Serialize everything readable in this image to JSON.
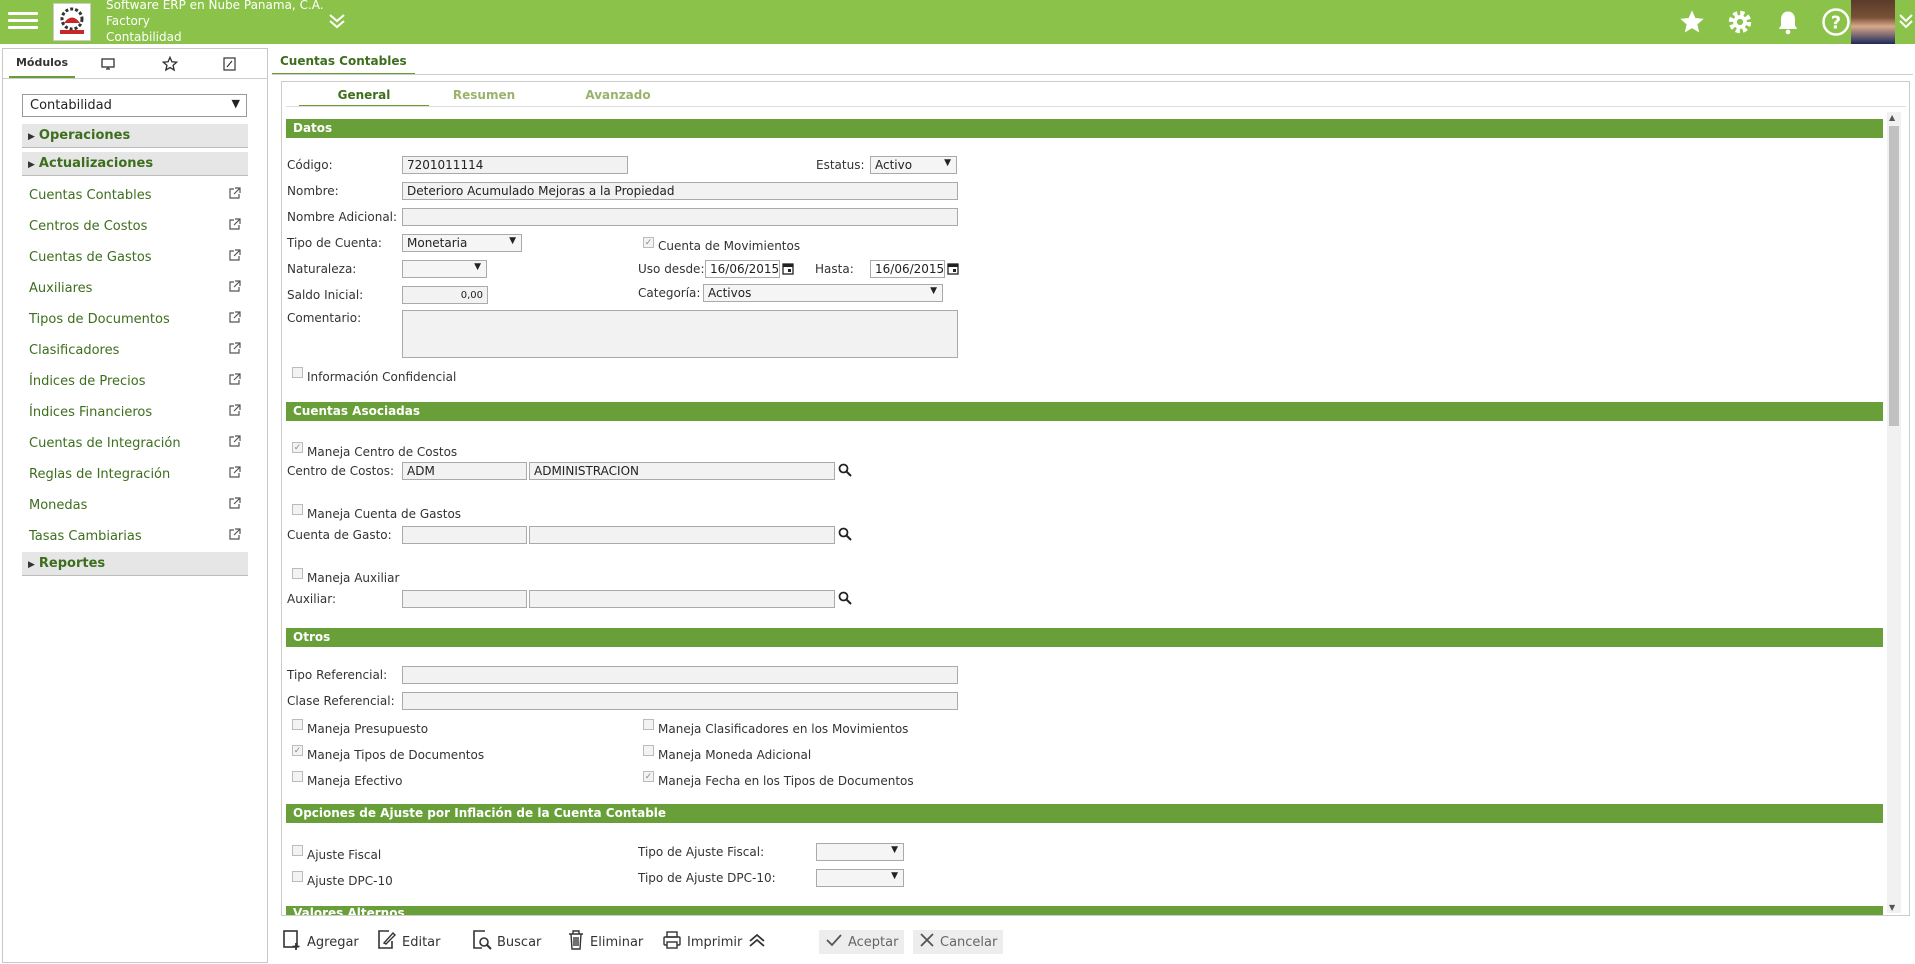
{
  "header": {
    "company": "Software ERP en Nube Panama, C.A.",
    "app": "Factory",
    "module": "Contabilidad"
  },
  "sidebar": {
    "tab_modules": "Módulos",
    "module_select": "Contabilidad",
    "groups": {
      "operaciones": "Operaciones",
      "actualizaciones": "Actualizaciones",
      "reportes": "Reportes"
    },
    "items": [
      {
        "label": "Cuentas Contables"
      },
      {
        "label": "Centros de Costos"
      },
      {
        "label": "Cuentas de Gastos"
      },
      {
        "label": "Auxiliares"
      },
      {
        "label": "Tipos de Documentos"
      },
      {
        "label": "Clasificadores"
      },
      {
        "label": "Índices de Precios"
      },
      {
        "label": "Índices Financieros"
      },
      {
        "label": "Cuentas de Integración"
      },
      {
        "label": "Reglas de Integración"
      },
      {
        "label": "Monedas"
      },
      {
        "label": "Tasas Cambiarias"
      }
    ]
  },
  "main": {
    "tab_title": "Cuentas Contables",
    "subtabs": [
      "General",
      "Resumen",
      "Avanzado"
    ],
    "sections": {
      "datos": "Datos",
      "cuentas_asociadas": "Cuentas Asociadas",
      "otros": "Otros",
      "ajuste": "Opciones de Ajuste por Inflación de la Cuenta Contable",
      "valores": "Valores Alternos"
    },
    "form": {
      "codigo_label": "Código:",
      "codigo_value": "7201011114",
      "estatus_label": "Estatus:",
      "estatus_value": "Activo",
      "nombre_label": "Nombre:",
      "nombre_value": "Deterioro Acumulado Mejoras a la Propiedad",
      "nombre_adicional_label": "Nombre Adicional:",
      "nombre_adicional_value": "",
      "tipo_cuenta_label": "Tipo de Cuenta:",
      "tipo_cuenta_value": "Monetaria",
      "cuenta_movimientos_label": "Cuenta de Movimientos",
      "naturaleza_label": "Naturaleza:",
      "uso_desde_label": "Uso desde:",
      "uso_desde_value": "16/06/2015",
      "hasta_label": "Hasta:",
      "hasta_value": "16/06/2015",
      "saldo_inicial_label": "Saldo Inicial:",
      "saldo_inicial_value": "0,00",
      "categoria_label": "Categoría:",
      "categoria_value": "Activos",
      "comentario_label": "Comentario:",
      "info_confidencial_label": "Información Confidencial",
      "maneja_centro_label": "Maneja Centro de Costos",
      "centro_costos_label": "Centro de Costos:",
      "centro_costos_code": "ADM",
      "centro_costos_name": "ADMINISTRACION",
      "maneja_cuenta_gastos_label": "Maneja Cuenta de Gastos",
      "cuenta_gasto_label": "Cuenta de Gasto:",
      "maneja_auxiliar_label": "Maneja Auxiliar",
      "auxiliar_label": "Auxiliar:",
      "tipo_referencial_label": "Tipo Referencial:",
      "clase_referencial_label": "Clase Referencial:",
      "maneja_presupuesto_label": "Maneja Presupuesto",
      "maneja_clasificadores_label": "Maneja Clasificadores en los Movimientos",
      "maneja_tipos_docs_label": "Maneja Tipos de Documentos",
      "maneja_moneda_adicional_label": "Maneja Moneda Adicional",
      "maneja_efectivo_label": "Maneja Efectivo",
      "maneja_fecha_label": "Maneja Fecha en los Tipos de Documentos",
      "ajuste_fiscal_label": "Ajuste Fiscal",
      "tipo_ajuste_fiscal_label": "Tipo de Ajuste Fiscal:",
      "ajuste_dpc_label": "Ajuste DPC-10",
      "tipo_ajuste_dpc_label": "Tipo de Ajuste DPC-10:"
    }
  },
  "toolbar": {
    "agregar": "Agregar",
    "editar": "Editar",
    "buscar": "Buscar",
    "eliminar": "Eliminar",
    "imprimir": "Imprimir",
    "aceptar": "Aceptar",
    "cancelar": "Cancelar"
  },
  "colors": {
    "topbar": "#8bc34a",
    "section": "#689f38",
    "link": "#3d6e1d"
  }
}
